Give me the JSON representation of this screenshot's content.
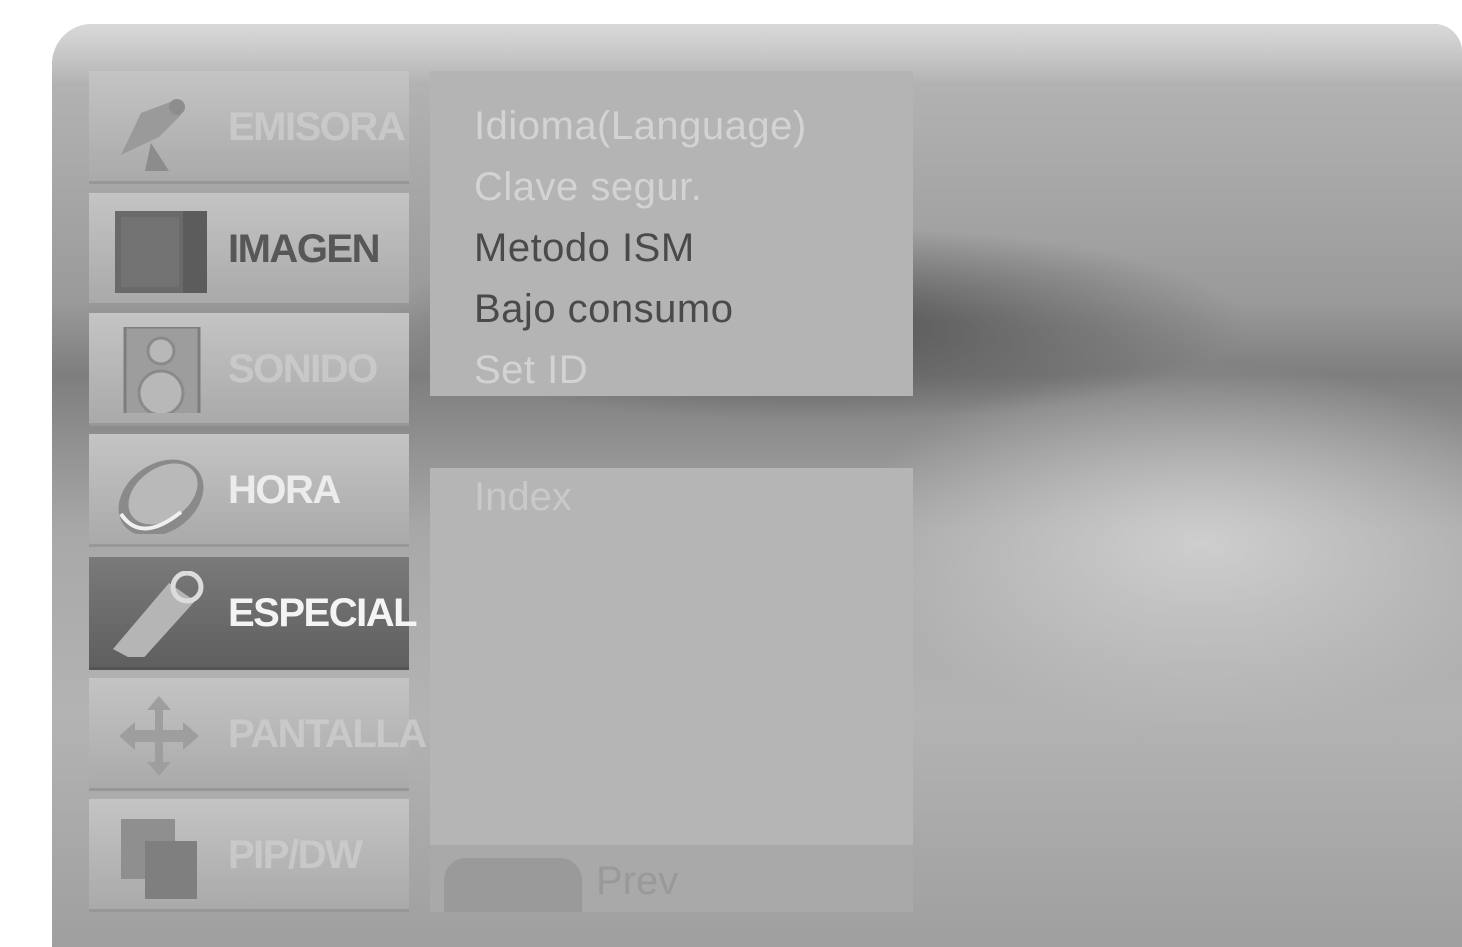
{
  "menu": {
    "categories": [
      {
        "label": "EMISORA",
        "icon": "satellite-dish-icon",
        "state": "dim"
      },
      {
        "label": "IMAGEN",
        "icon": "picture-icon",
        "state": "normal"
      },
      {
        "label": "SONIDO",
        "icon": "speaker-icon",
        "state": "dim"
      },
      {
        "label": "HORA",
        "icon": "clock-icon",
        "state": "normal"
      },
      {
        "label": "ESPECIAL",
        "icon": "tag-icon",
        "state": "selected"
      },
      {
        "label": "PANTALLA",
        "icon": "move-arrows-icon",
        "state": "dim"
      },
      {
        "label": "PIP/DW",
        "icon": "pip-windows-icon",
        "state": "dim"
      }
    ]
  },
  "submenu": {
    "items": [
      {
        "label": "Idioma(Language)",
        "state": "dim"
      },
      {
        "label": "Clave segur.",
        "state": "dim"
      },
      {
        "label": "Metodo ISM",
        "state": "active"
      },
      {
        "label": "Bajo consumo",
        "state": "active"
      },
      {
        "label": "Set ID",
        "state": "dim"
      }
    ]
  },
  "index_panel": {
    "title": "Index"
  },
  "footer": {
    "prev_label": "Prev"
  },
  "colors": {
    "selected_category_bg": "#6b6b6b",
    "submenu_bg": "#b4b4b4",
    "text_active": "#4a4a4a",
    "text_dim": "#d0d0d0"
  }
}
